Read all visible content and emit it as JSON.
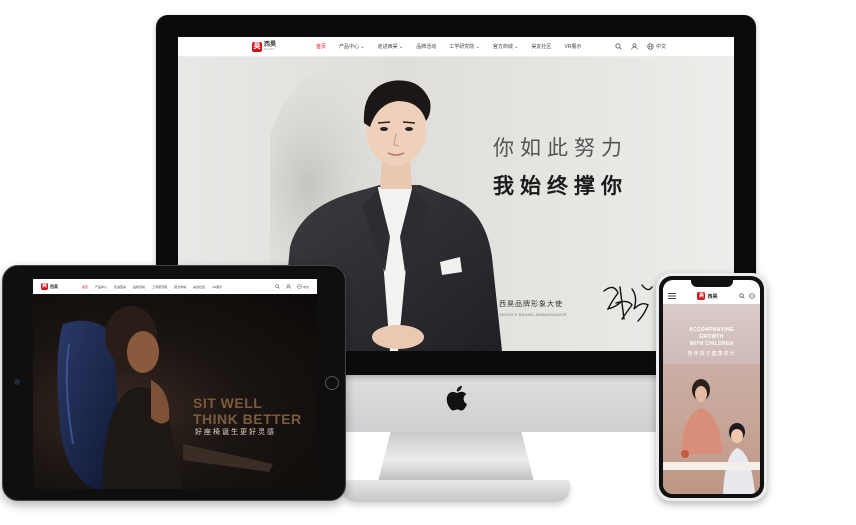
{
  "colors": {
    "brand_red": "#d7141b",
    "ipad_title": "#7c5a3e"
  },
  "brand": {
    "logo_cn": "西昊",
    "logo_en": "SIHOO",
    "logo_mark": "昊"
  },
  "desktop": {
    "nav": {
      "items": [
        {
          "label": "首页",
          "active": true
        },
        {
          "label": "产品中心 ⌄"
        },
        {
          "label": "走进西昊 ⌄"
        },
        {
          "label": "品牌活动"
        },
        {
          "label": "工学研究院 ⌄"
        },
        {
          "label": "官方商城 ⌄"
        },
        {
          "label": "昊友社区"
        },
        {
          "label": "VR展示"
        }
      ],
      "icons": [
        "search-icon",
        "user-icon",
        "globe-icon"
      ],
      "lang": "中文"
    },
    "hero": {
      "slogan_line1": "你如此努力",
      "slogan_line2": "我始终撑你",
      "ambassador_cn": "西昊品牌形象大使",
      "ambassador_en": "SIHOO'S BRAND AMBASSADOR"
    }
  },
  "tablet": {
    "nav": {
      "items": [
        "首页",
        "产品中心",
        "走进西昊",
        "品牌活动",
        "工学研究院",
        "官方商城",
        "昊友社区",
        "VR展示"
      ],
      "lang": "中文"
    },
    "hero": {
      "title_line1": "SIT WELL",
      "title_line2": "THINK BETTER",
      "subtitle": "好座椅诞生更好灵感"
    }
  },
  "phone": {
    "hero": {
      "line1": "ACCOMPANYING",
      "line2": "GROWTH",
      "line3": "WITH CHILDREN",
      "subtitle": "陪伴孩子健康成长"
    }
  }
}
